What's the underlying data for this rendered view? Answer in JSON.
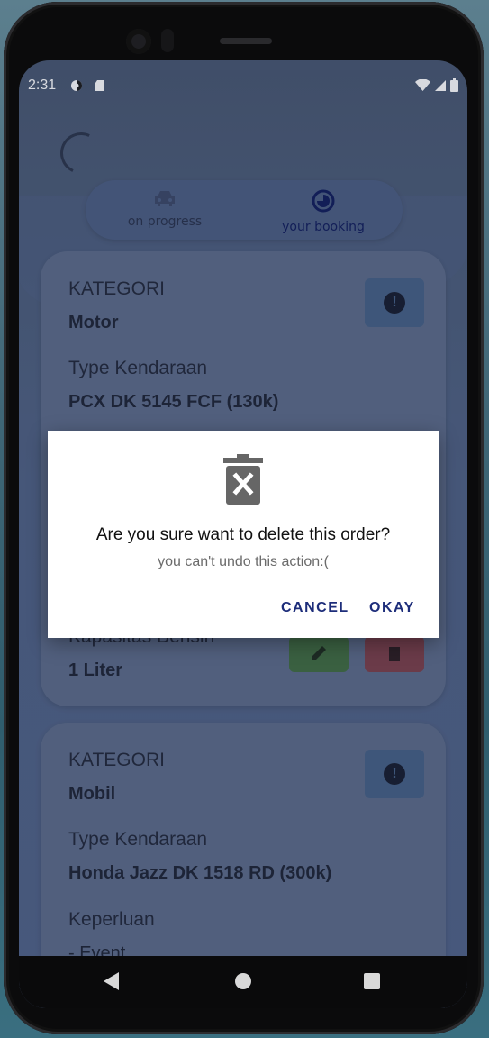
{
  "status_bar": {
    "time": "2:31"
  },
  "segmented": {
    "left_label": "on progress",
    "right_label": "your booking",
    "selected": "your booking"
  },
  "cards": [
    {
      "kategori_label": "KATEGORI",
      "kategori_value": "Motor",
      "type_label": "Type Kendaraan",
      "type_value": "PCX DK 5145 FCF (130k)",
      "kapasitas_label": "Kapasitas Bensin",
      "kapasitas_value": "1 Liter"
    },
    {
      "kategori_label": "KATEGORI",
      "kategori_value": "Mobil",
      "type_label": "Type Kendaraan",
      "type_value": "Honda Jazz DK 1518 RD (300k)",
      "keperluan_label": "Keperluan",
      "keperluan_value": "- Event"
    }
  ],
  "dialog": {
    "title": "Are you sure want to delete this order?",
    "subtitle": "you can't undo this action:(",
    "cancel_label": "CANCEL",
    "okay_label": "OKAY"
  },
  "colors": {
    "accent": "#1d2d7a",
    "edit": "#3f6b3f",
    "delete": "#7a3d48",
    "info": "#445f84"
  }
}
